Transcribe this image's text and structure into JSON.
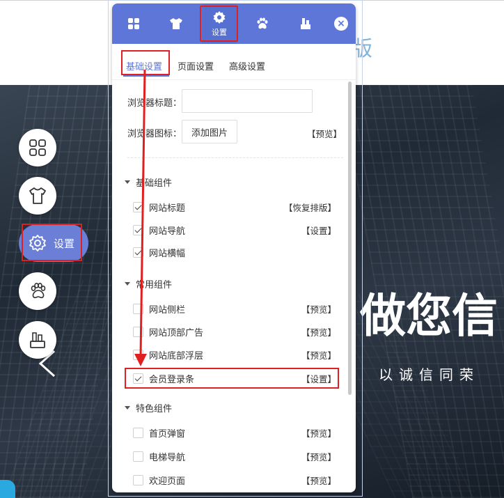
{
  "hero": {
    "title": "做您信",
    "subtitle": "以诚信同荣"
  },
  "dock": {
    "settings_label": "设置"
  },
  "panel": {
    "active_tab_label": "设置",
    "tabs": [
      "grid-icon",
      "shirt-icon",
      "gear-icon",
      "paw-icon",
      "tool-icon"
    ],
    "close": "×"
  },
  "subtabs": [
    "基础设置",
    "页面设置",
    "高级设置"
  ],
  "browser": {
    "title_label": "浏览器标题：",
    "title_value": "",
    "icon_label": "浏览器图标：",
    "add_image": "添加图片",
    "preview": "【预览】"
  },
  "sections": [
    {
      "title": "基础组件",
      "items": [
        {
          "label": "网站标题",
          "checked": true,
          "action": "【恢复排版】"
        },
        {
          "label": "网站导航",
          "checked": true,
          "action": "【设置】"
        },
        {
          "label": "网站横幅",
          "checked": true,
          "action": ""
        }
      ]
    },
    {
      "title": "常用组件",
      "items": [
        {
          "label": "网站侧栏",
          "checked": false,
          "action": "【预览】"
        },
        {
          "label": "网站顶部广告",
          "checked": false,
          "action": "【预览】"
        },
        {
          "label": "网站底部浮层",
          "checked": false,
          "action": "【预览】"
        },
        {
          "label": "会员登录条",
          "checked": true,
          "action": "【设置】"
        }
      ]
    },
    {
      "title": "特色组件",
      "items": [
        {
          "label": "首页弹窗",
          "checked": false,
          "action": "【预览】"
        },
        {
          "label": "电梯导航",
          "checked": false,
          "action": "【预览】"
        },
        {
          "label": "欢迎页面",
          "checked": false,
          "action": "【预览】"
        }
      ]
    }
  ],
  "colors": {
    "accent": "#5d76d7",
    "annotation": "#e02020"
  }
}
